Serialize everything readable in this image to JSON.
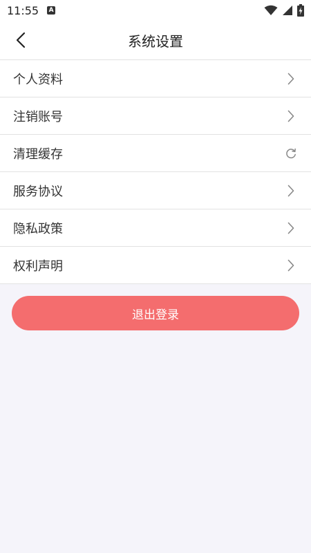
{
  "status_bar": {
    "time": "11:55",
    "notification_icon_letter": "A"
  },
  "header": {
    "title": "系统设置",
    "back_icon": "chevron-left-icon"
  },
  "menu": {
    "items": [
      {
        "label": "个人资料",
        "icon": "chevron-right-icon"
      },
      {
        "label": "注销账号",
        "icon": "chevron-right-icon"
      },
      {
        "label": "清理缓存",
        "icon": "refresh-icon"
      },
      {
        "label": "服务协议",
        "icon": "chevron-right-icon"
      },
      {
        "label": "隐私政策",
        "icon": "chevron-right-icon"
      },
      {
        "label": "权利声明",
        "icon": "chevron-right-icon"
      }
    ]
  },
  "logout": {
    "label": "退出登录"
  },
  "colors": {
    "page_background": "#f5f4fa",
    "logout_button": "#f46d6e",
    "divider": "#e2e2e2",
    "chevron": "#888888"
  }
}
